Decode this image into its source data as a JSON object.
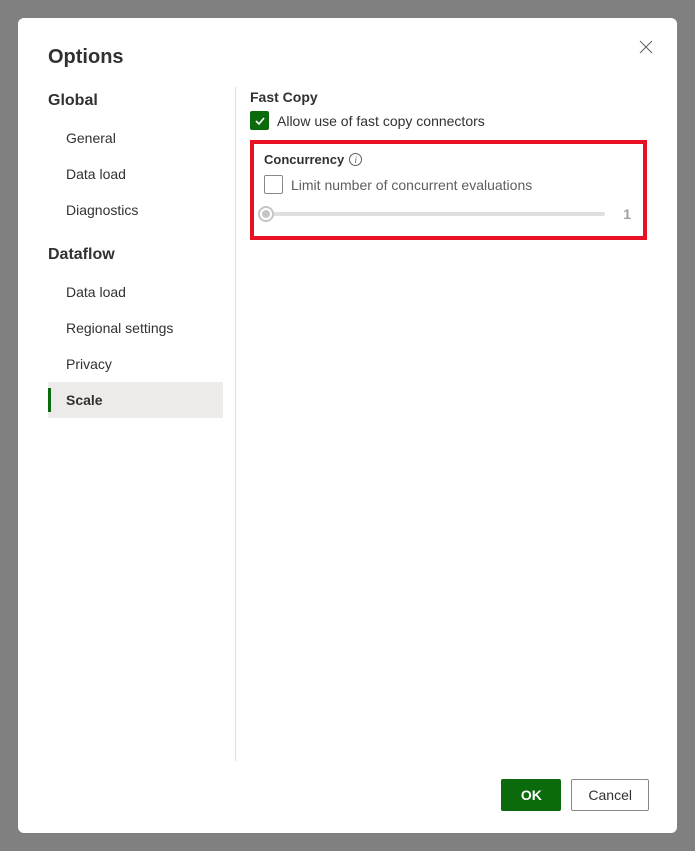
{
  "title": "Options",
  "sidebar": {
    "sections": [
      {
        "header": "Global",
        "items": [
          "General",
          "Data load",
          "Diagnostics"
        ]
      },
      {
        "header": "Dataflow",
        "items": [
          "Data load",
          "Regional settings",
          "Privacy",
          "Scale"
        ]
      }
    ],
    "selected": "Scale"
  },
  "main": {
    "fast_copy": {
      "label": "Fast Copy",
      "checkbox_label": "Allow use of fast copy connectors",
      "checked": true
    },
    "concurrency": {
      "label": "Concurrency",
      "checkbox_label": "Limit number of concurrent evaluations",
      "checked": false,
      "slider_value": "1"
    }
  },
  "footer": {
    "ok": "OK",
    "cancel": "Cancel"
  }
}
